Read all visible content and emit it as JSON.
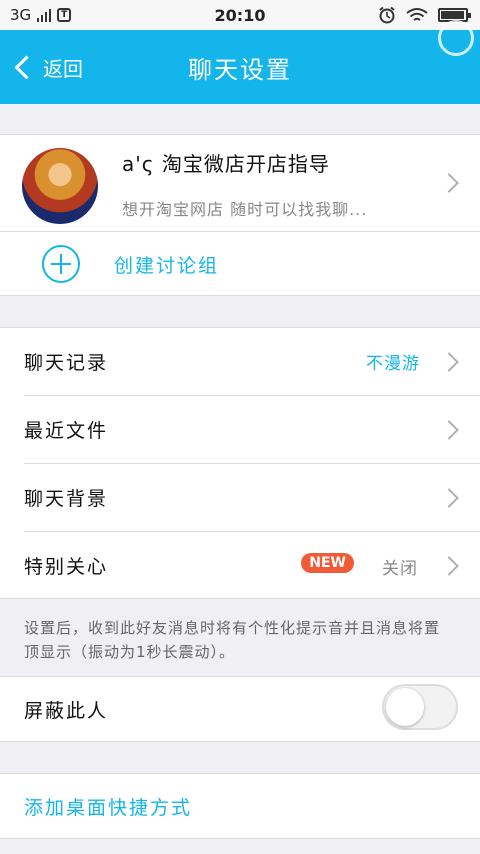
{
  "status_bar": {
    "network": "3G",
    "carrier_icon": "T",
    "time": "20:10",
    "icons": [
      "alarm-icon",
      "wifi-icon",
      "battery-icon"
    ],
    "battery_level": 0.95
  },
  "header": {
    "back_label": "返回",
    "title": "聊天设置"
  },
  "profile": {
    "name": "a'ς  淘宝微店开店指导",
    "signature": "想开淘宝网店  随时可以找我聊..."
  },
  "create_group": {
    "label": "创建讨论组"
  },
  "settings": {
    "chat_history": {
      "label": "聊天记录",
      "value": "不漫游"
    },
    "recent_files": {
      "label": "最近文件"
    },
    "chat_background": {
      "label": "聊天背景"
    },
    "special_care": {
      "label": "特别关心",
      "badge": "NEW",
      "value": "关闭"
    }
  },
  "special_care_note": "设置后，收到此好友消息时将有个性化提示音并且消息将置顶显示（振动为1秒长震动）。",
  "block": {
    "label": "屏蔽此人",
    "enabled": false
  },
  "shortcut": {
    "label": "添加桌面快捷方式"
  },
  "colors": {
    "accent": "#13b5ea",
    "badge": "#f05a36",
    "background": "#efeff4"
  }
}
